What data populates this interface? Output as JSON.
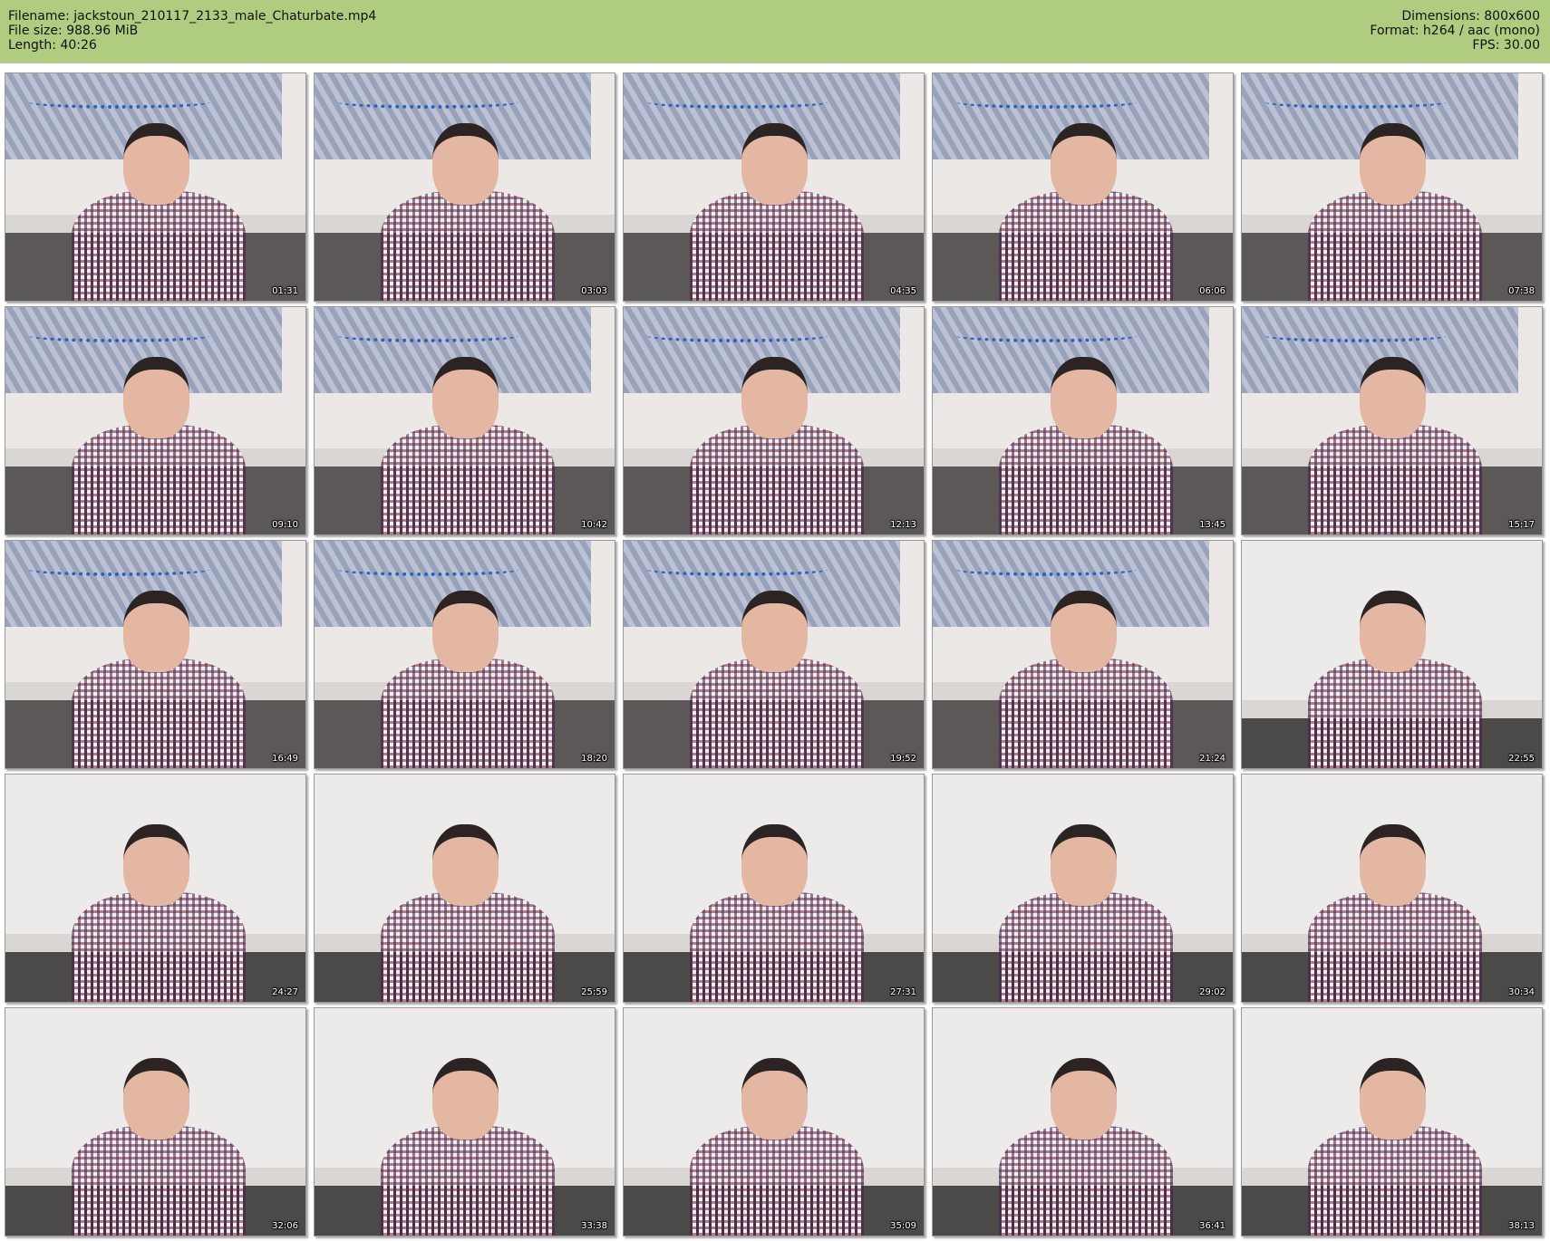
{
  "header": {
    "filename": "Filename: jackstoun_210117_2133_male_Chaturbate.mp4",
    "file_size": "File size: 988.96 MiB",
    "length": "Length: 40:26",
    "dimensions": "Dimensions: 800x600",
    "format": "Format: h264 / aac (mono)",
    "fps": "FPS: 30.00"
  },
  "thumbnails": [
    {
      "timestamp": "01:31"
    },
    {
      "timestamp": "03:03"
    },
    {
      "timestamp": "04:35"
    },
    {
      "timestamp": "06:06"
    },
    {
      "timestamp": "07:38"
    },
    {
      "timestamp": "09:10"
    },
    {
      "timestamp": "10:42"
    },
    {
      "timestamp": "12:13"
    },
    {
      "timestamp": "13:45"
    },
    {
      "timestamp": "15:17"
    },
    {
      "timestamp": "16:49"
    },
    {
      "timestamp": "18:20"
    },
    {
      "timestamp": "19:52"
    },
    {
      "timestamp": "21:24"
    },
    {
      "timestamp": "22:55"
    },
    {
      "timestamp": "24:27"
    },
    {
      "timestamp": "25:59"
    },
    {
      "timestamp": "27:31"
    },
    {
      "timestamp": "29:02"
    },
    {
      "timestamp": "30:34"
    },
    {
      "timestamp": "32:06"
    },
    {
      "timestamp": "33:38"
    },
    {
      "timestamp": "35:09"
    },
    {
      "timestamp": "36:41"
    },
    {
      "timestamp": "38:13"
    }
  ],
  "colors": {
    "header_bg": "#b0cc7e",
    "page_bg": "#ffffff"
  }
}
